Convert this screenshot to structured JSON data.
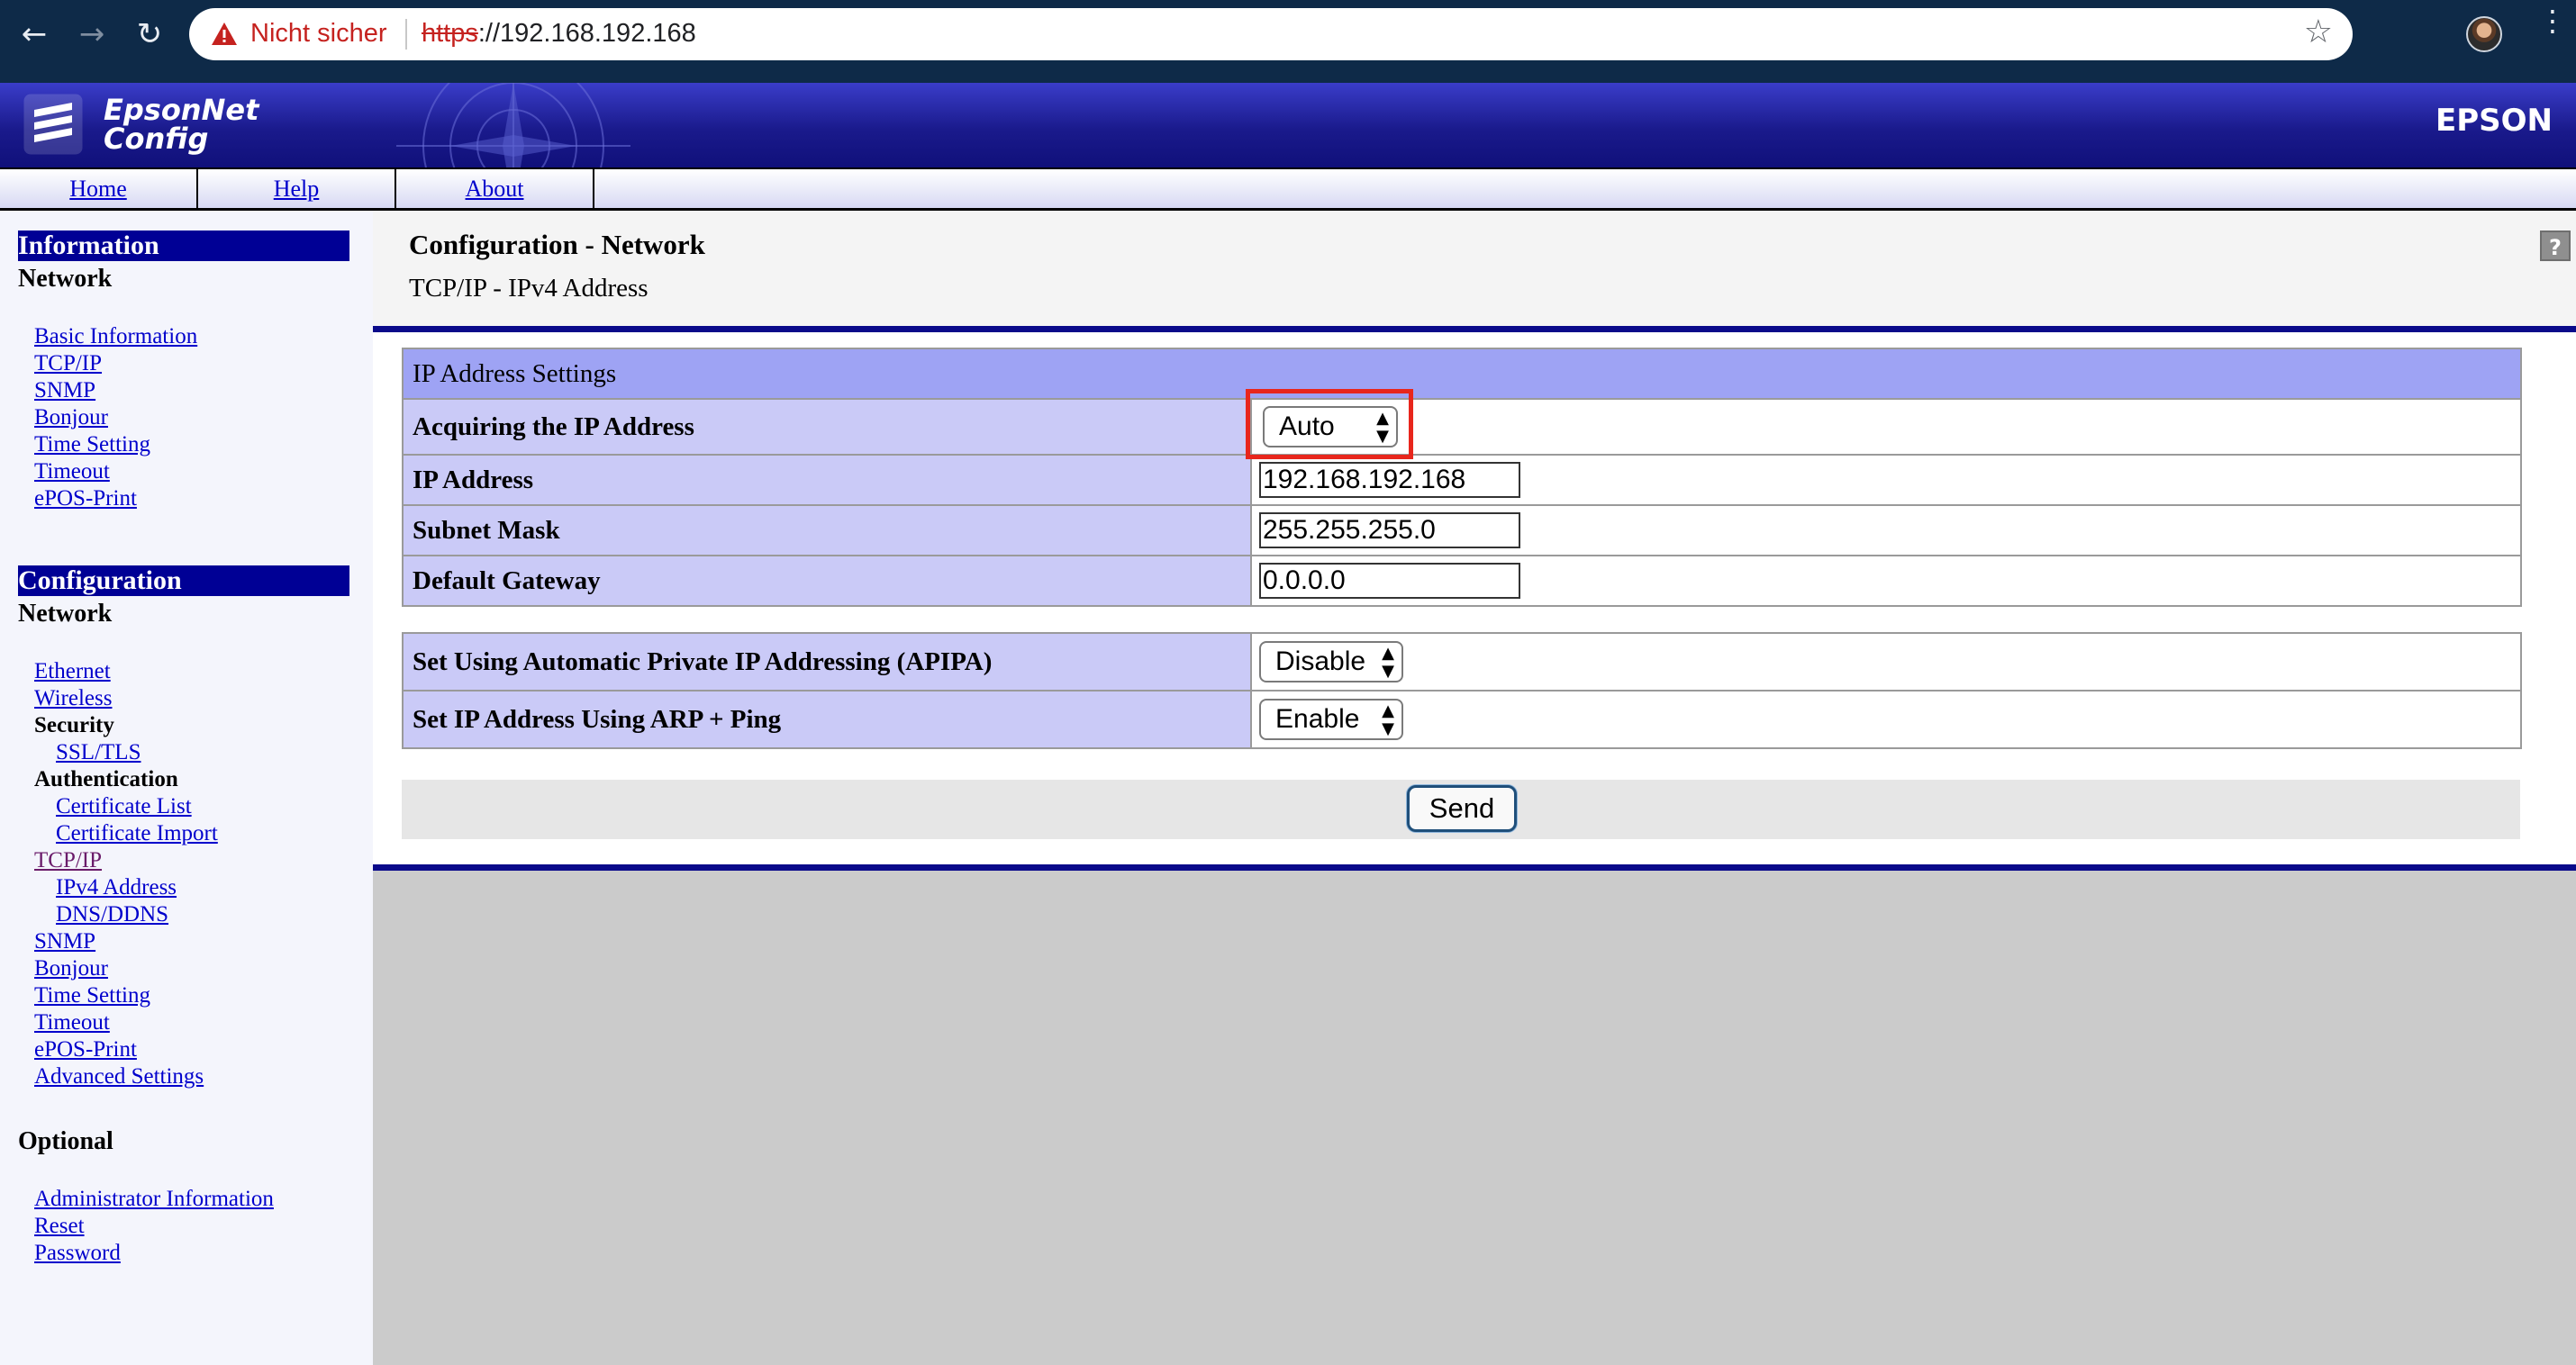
{
  "browser": {
    "security_label": "Nicht sicher",
    "url_scheme": "https",
    "url_rest": "://192.168.192.168"
  },
  "banner": {
    "title_line1": "EpsonNet",
    "title_line2": "Config",
    "brand": "EPSON"
  },
  "topmenu": [
    "Home",
    "Help",
    "About"
  ],
  "leftnav": {
    "information": {
      "header": "Information",
      "subheader": "Network",
      "links": [
        "Basic Information",
        "TCP/IP",
        "SNMP",
        "Bonjour",
        "Time Setting",
        "Timeout",
        "ePOS-Print"
      ]
    },
    "configuration": {
      "header": "Configuration",
      "subheader": "Network",
      "ethernet": "Ethernet",
      "wireless": "Wireless",
      "security": "Security",
      "ssl_tls": "SSL/TLS",
      "authentication": "Authentication",
      "certificate_list": "Certificate List",
      "certificate_import": "Certificate Import",
      "tcpip": "TCP/IP",
      "ipv4_address": "IPv4 Address",
      "dns_ddns": "DNS/DDNS",
      "snmp": "SNMP",
      "bonjour": "Bonjour",
      "time_setting": "Time Setting",
      "timeout": "Timeout",
      "epos_print": "ePOS-Print",
      "advanced_settings": "Advanced Settings"
    },
    "optional": {
      "header": "Optional",
      "links": [
        "Administrator Information",
        "Reset",
        "Password"
      ]
    }
  },
  "main": {
    "title": "Configuration - Network",
    "subtitle": "TCP/IP - IPv4 Address",
    "ip_settings": {
      "group_title": "IP Address Settings",
      "acquire_label": "Acquiring the IP Address",
      "acquire_value": "Auto",
      "ip_label": "IP Address",
      "ip_value": "192.168.192.168",
      "subnet_label": "Subnet Mask",
      "subnet_value": "255.255.255.0",
      "gateway_label": "Default Gateway",
      "gateway_value": "0.0.0.0"
    },
    "apipa": {
      "label": "Set Using Automatic Private IP Addressing (APIPA)",
      "value": "Disable"
    },
    "arp_ping": {
      "label": "Set IP Address Using ARP + Ping",
      "value": "Enable"
    },
    "send_label": "Send"
  },
  "colors": {
    "nav_header_bg": "#000095",
    "link": "#0000cc",
    "label_cell_bg": "#cacaf7",
    "group_head_bg": "#9ea3f4",
    "highlight": "#e8261c"
  }
}
